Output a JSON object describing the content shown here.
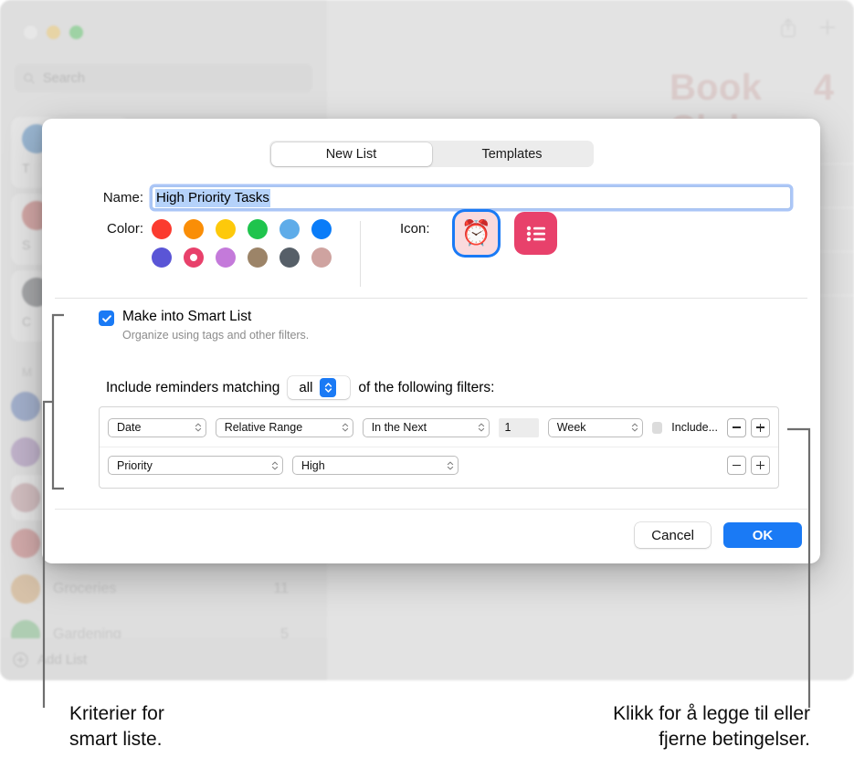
{
  "app": {
    "search_placeholder": "Search",
    "title": "Book Club",
    "count": "4",
    "share_icon": "share-icon",
    "add_icon": "plus-icon",
    "add_list_label": "Add List",
    "sidebar_tiles": [
      {
        "label": "T",
        "color": "#3a8ddd"
      },
      {
        "label": "S",
        "color": "#e2645f"
      },
      {
        "label": "C",
        "color": "#6c6f75"
      },
      {
        "label": "M",
        "color": "#aaaaaa"
      }
    ],
    "sidebar_section": "M",
    "sidebar_rows": [
      {
        "name": "",
        "count": "",
        "color": "#5a7fd0",
        "selected": false
      },
      {
        "name": "",
        "count": "",
        "color": "#a57cc4",
        "selected": false
      },
      {
        "name": "",
        "count": "",
        "color": "#c98e96",
        "selected": true
      },
      {
        "name": "",
        "count": "",
        "color": "#dd6a6a",
        "selected": false
      },
      {
        "name": "Groceries",
        "count": "11",
        "color": "#d79a4e",
        "selected": false
      },
      {
        "name": "Gardening",
        "count": "5",
        "color": "#5fb96b",
        "selected": false
      },
      {
        "name": "",
        "count": "",
        "color": "#5a8bd8",
        "selected": false
      }
    ]
  },
  "dialog": {
    "tabs": [
      {
        "label": "New List",
        "active": true
      },
      {
        "label": "Templates",
        "active": false
      }
    ],
    "name_label": "Name:",
    "name_value": "High Priority Tasks",
    "color_label": "Color:",
    "colors": [
      {
        "hex": "#fb3b2f",
        "selected": false
      },
      {
        "hex": "#fa8e07",
        "selected": false
      },
      {
        "hex": "#fdc90b",
        "selected": false
      },
      {
        "hex": "#1fc44d",
        "selected": false
      },
      {
        "hex": "#5eace9",
        "selected": false
      },
      {
        "hex": "#0a7cf8",
        "selected": false
      },
      {
        "hex": "#5a55d6",
        "selected": false
      },
      {
        "hex": "#e8416b",
        "selected": true
      },
      {
        "hex": "#c47ada",
        "selected": false
      },
      {
        "hex": "#9c8468",
        "selected": false
      },
      {
        "hex": "#565f68",
        "selected": false
      },
      {
        "hex": "#cfa3a0",
        "selected": false
      }
    ],
    "icon_label": "Icon:",
    "icons": [
      {
        "name": "alarm-clock-icon",
        "glyph": "⏰",
        "kind": "emoji",
        "selected": true
      },
      {
        "name": "bulleted-list-icon",
        "glyph": "",
        "kind": "glyph",
        "selected": false
      }
    ],
    "smart_list": {
      "checked": true,
      "title": "Make into Smart List",
      "subtitle": "Organize using tags and other filters."
    },
    "include_prefix": "Include reminders matching",
    "include_match": "all",
    "include_suffix": "of the following filters:",
    "filters": [
      {
        "field": "Date",
        "operator": "Relative Range",
        "qualifier": "In the Next",
        "amount": "1",
        "unit": "Week",
        "extra_checkbox_label": "Include...",
        "extra_checkbox_checked": false
      },
      {
        "field": "Priority",
        "operator": "High"
      }
    ],
    "remove_button_label": "−",
    "add_button_label": "+",
    "cancel_label": "Cancel",
    "ok_label": "OK"
  },
  "callouts": {
    "left": "Kriterier for\nsmart liste.",
    "left_line1": "Kriterier for",
    "left_line2": "smart liste.",
    "right_line1": "Klikk for å legge til eller",
    "right_line2": "fjerne betingelser."
  },
  "colors": {
    "accent": "#1a7af5",
    "selected_text": "#b5d2fa",
    "title_tint": "#d4a7a4"
  }
}
